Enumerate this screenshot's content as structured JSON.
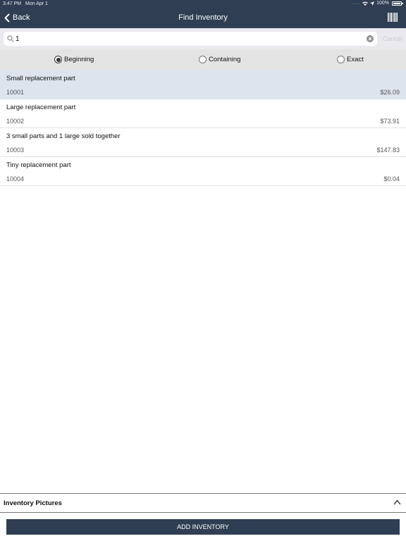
{
  "status_bar": {
    "time": "3:47 PM",
    "date": "Mon Apr 1",
    "battery": "100%"
  },
  "nav": {
    "back_label": "Back",
    "title": "Find Inventory",
    "barcode_icon": "barcode-icon"
  },
  "search": {
    "value": "1",
    "placeholder": "",
    "cancel_label": "Cancel"
  },
  "match_modes": {
    "options": [
      "Beginning",
      "Containing",
      "Exact"
    ],
    "selected": "Beginning"
  },
  "results": [
    {
      "name": "Small replacement part",
      "id": "10001",
      "price": "$26.09"
    },
    {
      "name": "Large replacement part",
      "id": "10002",
      "price": "$73.91"
    },
    {
      "name": "3 small parts and 1 large sold together",
      "id": "10003",
      "price": "$147.83"
    },
    {
      "name": "Tiny replacement part",
      "id": "10004",
      "price": "$0.04"
    }
  ],
  "pictures_panel": {
    "label": "Inventory Pictures"
  },
  "add_button": {
    "label": "ADD INVENTORY"
  },
  "colors": {
    "nav_bg": "#2f3e52",
    "selected_row": "#dde4ee",
    "segment_bg": "#e4e4e4"
  }
}
